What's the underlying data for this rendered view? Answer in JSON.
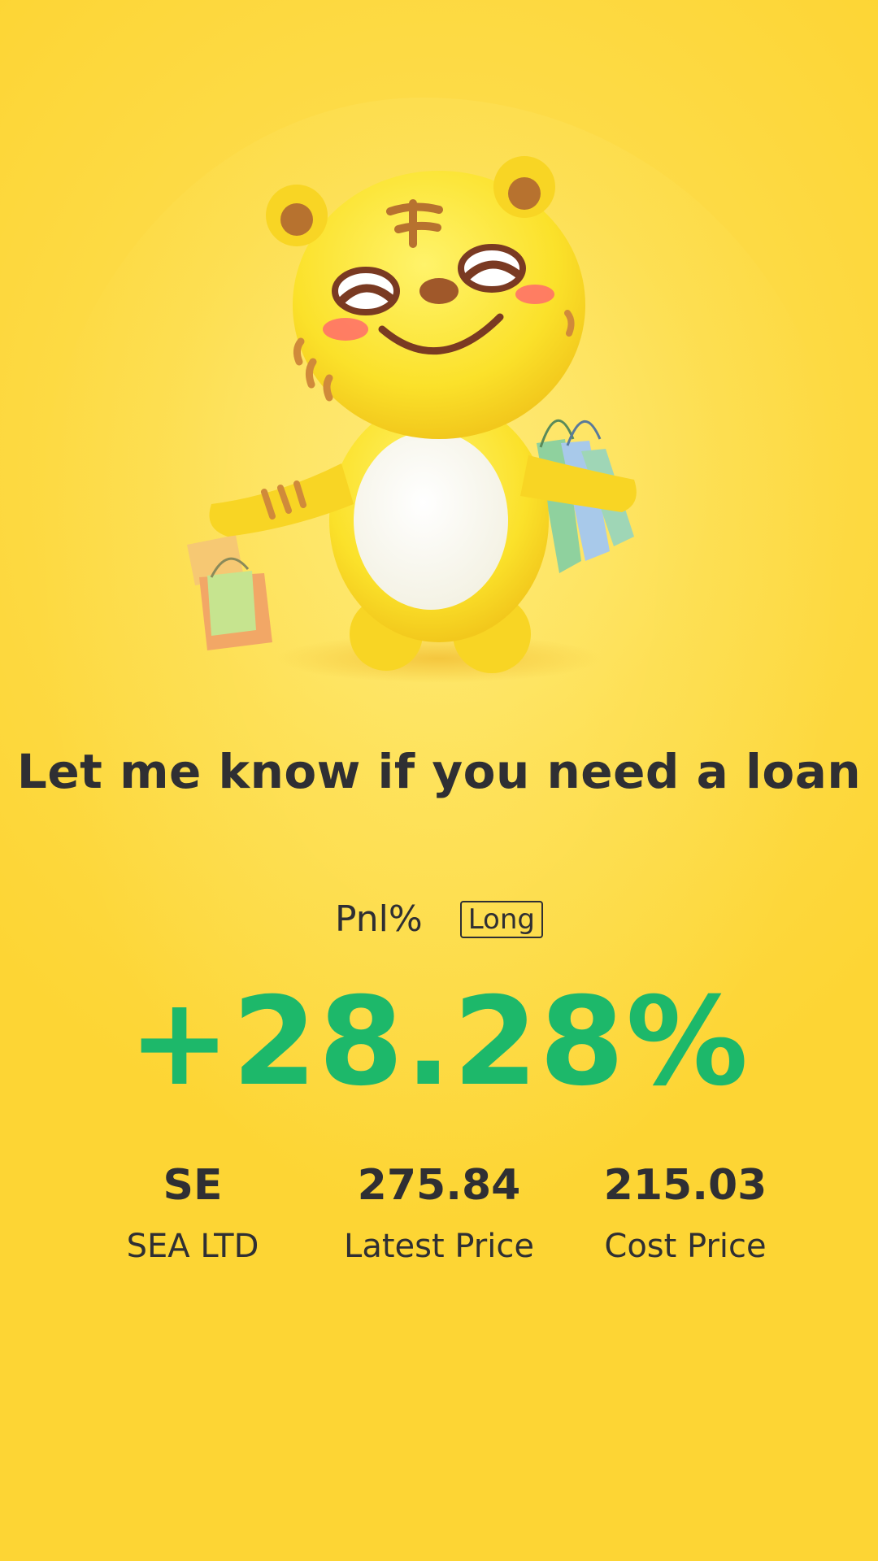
{
  "headline": "Let me know if you need a loan",
  "pnl": {
    "label": "Pnl%",
    "direction_badge": "Long",
    "value": "+28.28%"
  },
  "stats": {
    "ticker": {
      "value": "SE",
      "label": "SEA LTD"
    },
    "latest_price": {
      "value": "275.84",
      "label": "Latest Price"
    },
    "cost_price": {
      "value": "215.03",
      "label": "Cost Price"
    }
  },
  "colors": {
    "background": "#fdd534",
    "text": "#2f2f33",
    "positive": "#1db86a"
  },
  "mascot": {
    "icon": "tiger-mascot-with-shopping-bags-icon"
  }
}
